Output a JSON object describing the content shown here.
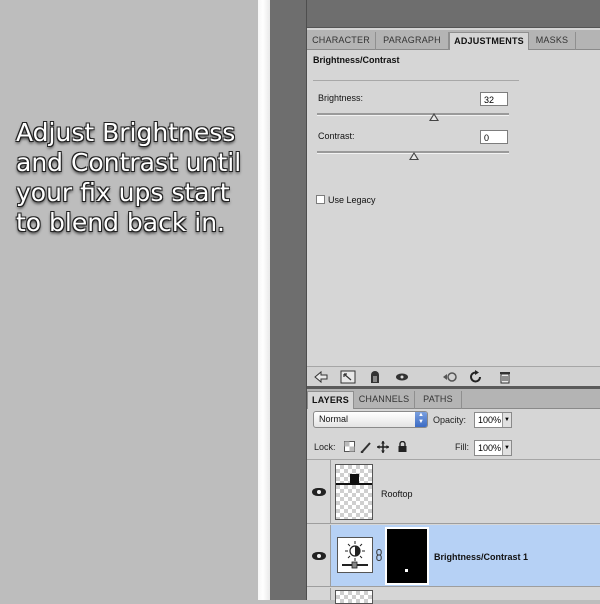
{
  "caption": "Adjust Brightness\nand Contrast until\nyour fix ups start\nto blend back in.",
  "top_tabs": [
    "CHARACTER",
    "PARAGRAPH",
    "ADJUSTMENTS",
    "MASKS"
  ],
  "adjustments": {
    "title": "Brightness/Contrast",
    "brightness_label": "Brightness:",
    "brightness_value": "32",
    "contrast_label": "Contrast:",
    "contrast_value": "0",
    "use_legacy_label": "Use Legacy"
  },
  "adj_toolbar_icons": [
    "back-arrow-icon",
    "expand-view-icon",
    "clip-to-layer-icon",
    "visibility-eye-icon",
    "previous-state-icon",
    "reset-icon",
    "trash-icon"
  ],
  "layer_tabs": [
    "LAYERS",
    "CHANNELS",
    "PATHS"
  ],
  "layers_panel": {
    "blend_mode": "Normal",
    "opacity_label": "Opacity:",
    "opacity_value": "100%",
    "lock_label": "Lock:",
    "fill_label": "Fill:",
    "fill_value": "100%"
  },
  "layers": [
    {
      "name": "Rooftop",
      "selected": false
    },
    {
      "name": "Brightness/Contrast 1",
      "selected": true
    }
  ],
  "colors": {
    "selected_row": "#b6d1f5",
    "panel_bg": "#d6d6d6",
    "left_bg": "#bdbdbd"
  }
}
